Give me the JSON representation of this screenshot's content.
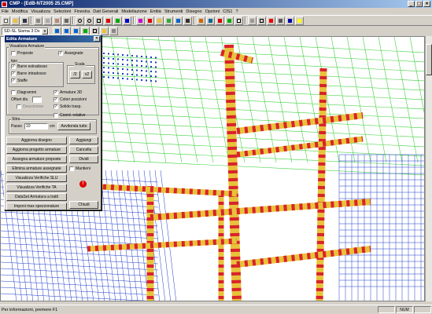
{
  "window": {
    "title": "CMP - [EdB-NT2005 25.CMP]",
    "minimize": "_",
    "maximize": "□",
    "close": "×"
  },
  "menu": [
    "File",
    "Modifica",
    "Visualizza",
    "Selezioni",
    "Finestra",
    "Dati Generali",
    "Modellazione",
    "Entità",
    "Strumenti",
    "Disegno",
    "Opzioni",
    "CIS1",
    "?"
  ],
  "toolbar2": {
    "combo_value": "SD-SL Sisma 3 Dx"
  },
  "dialog": {
    "title": "Edita Armature",
    "close": "×",
    "group_visualizza": "Visualizza Armature",
    "proposte": "Proposte",
    "proposte_checked": "",
    "assegnate": "Assegnate",
    "assegnate_checked": "✓",
    "group_tipo": "tipo",
    "barre_estradosso": "Barre estradosso",
    "barre_intradosso": "Barre intradosso",
    "staffe": "Staffe",
    "check_mark": "✓",
    "group_scala": "Scala",
    "scala_half": "/2",
    "scala_double": "x2",
    "diagrammi": "Diagrammi",
    "offset_dis": "Offset dis.",
    "descrizione": "Descrizione",
    "armature_3d": "Armature 3D",
    "colori_posizioni": "Colori posizioni",
    "solido_trasp": "Solido trasp.",
    "coord_relative": "Coord. relative",
    "group_stira": "Stira",
    "passo_label": "Passo",
    "passo_value": "10",
    "passo_unit": "cm",
    "avvitonda_tutto": "Avvitonda tutto",
    "aggiorna_disegno": "Aggiorna disegno",
    "aggiungi": "Aggiungi",
    "aggiorna_progetto": "Aggiorna progetto armature",
    "cancella": "Cancella",
    "assegna_proposte": "Assegna armature proposte",
    "dividi": "Dividi",
    "elimina_assegnate": "Elimina armature assegnate",
    "mantieni": "Mantieni",
    "verifiche_slu": "Visualizza Verifiche SLU",
    "verifiche_ta": "Visualizza Verifiche TA",
    "warning_glyph": "!",
    "dataset_tratti": "DataSet Armatura a tratti",
    "imponi_max": "Imponi max spezzonature",
    "chiudi": "Chiudi"
  },
  "status": {
    "text": "Per informazioni, premere F1",
    "num": "NUM"
  },
  "colors": {
    "frame_red": "#d8232a",
    "frame_yellow": "#e8c23a",
    "mesh_green": "#3ed23e",
    "mesh_blue": "#1f3cc8",
    "titlebar": "#0a246a"
  }
}
